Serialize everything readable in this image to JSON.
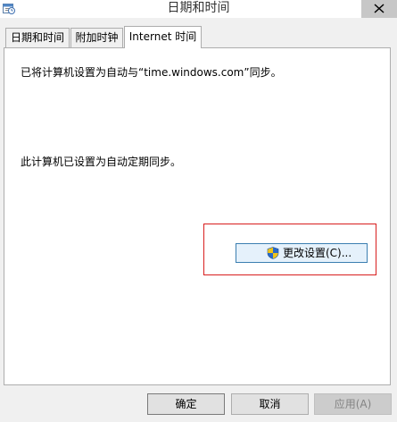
{
  "window": {
    "title": "日期和时间"
  },
  "tabs": [
    {
      "label": "日期和时间"
    },
    {
      "label": "附加时钟"
    },
    {
      "label": "Internet 时间"
    }
  ],
  "panel": {
    "sync_message": "已将计算机设置为自动与“time.windows.com”同步。",
    "schedule_message": "此计算机已设置为自动定期同步。",
    "change_settings_label": "更改设置(C)..."
  },
  "footer": {
    "ok_label": "确定",
    "cancel_label": "取消",
    "apply_label": "应用(A)"
  },
  "colors": {
    "highlight": "#d81e1e",
    "shield_blue": "#2a6bc8",
    "shield_yellow": "#f0c419"
  },
  "icons": {
    "title": "clock-calendar-icon",
    "close": "close-icon",
    "change": "uac-shield-icon"
  }
}
